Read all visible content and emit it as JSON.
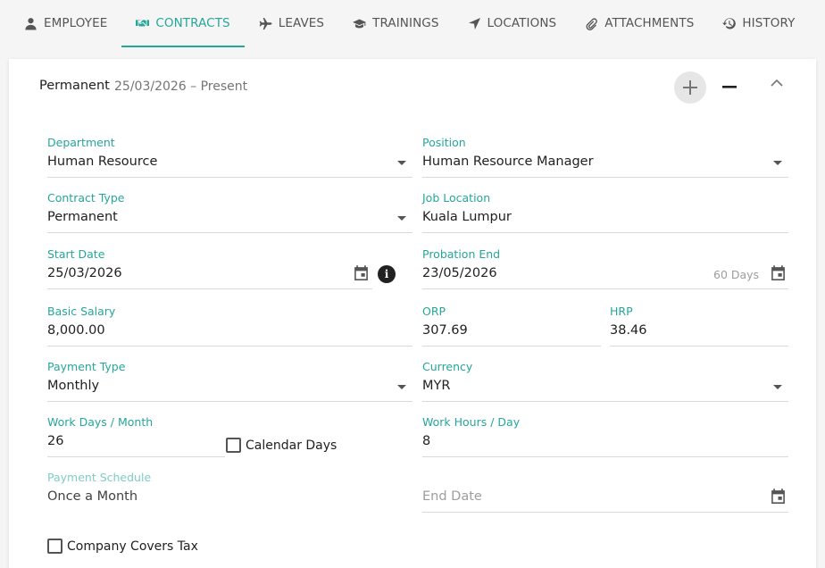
{
  "tabs": [
    {
      "label": "EMPLOYEE",
      "icon": "person-icon"
    },
    {
      "label": "CONTRACTS",
      "icon": "handshake-icon"
    },
    {
      "label": "LEAVES",
      "icon": "airplane-icon"
    },
    {
      "label": "TRAININGS",
      "icon": "graduation-cap-icon"
    },
    {
      "label": "LOCATIONS",
      "icon": "location-arrow-icon"
    },
    {
      "label": "ATTACHMENTS",
      "icon": "paperclip-icon"
    },
    {
      "label": "HISTORY",
      "icon": "history-icon"
    }
  ],
  "active_tab": "CONTRACTS",
  "accent_color": "#26a69a",
  "contract": {
    "header_type": "Permanent",
    "header_dates": "25/03/2026 – Present",
    "department": {
      "label": "Department",
      "value": "Human Resource"
    },
    "position": {
      "label": "Position",
      "value": "Human Resource Manager"
    },
    "contract_type": {
      "label": "Contract Type",
      "value": "Permanent"
    },
    "job_location": {
      "label": "Job Location",
      "value": "Kuala Lumpur"
    },
    "start_date": {
      "label": "Start Date",
      "value": "25/03/2026"
    },
    "probation_end": {
      "label": "Probation End",
      "value": "23/05/2026",
      "days": "60 Days"
    },
    "basic_salary": {
      "label": "Basic Salary",
      "value": "8,000.00"
    },
    "orp": {
      "label": "ORP",
      "value": "307.69"
    },
    "hrp": {
      "label": "HRP",
      "value": "38.46"
    },
    "payment_type": {
      "label": "Payment Type",
      "value": "Monthly"
    },
    "currency": {
      "label": "Currency",
      "value": "MYR"
    },
    "work_days": {
      "label": "Work Days / Month",
      "value": "26"
    },
    "calendar_days": {
      "label": "Calendar Days",
      "checked": false
    },
    "work_hours": {
      "label": "Work Hours / Day",
      "value": "8"
    },
    "payment_schedule": {
      "label": "Payment Schedule",
      "value": "Once a Month"
    },
    "end_date": {
      "placeholder": "End Date"
    },
    "company_covers_tax": {
      "label": "Company Covers Tax",
      "checked": false
    }
  }
}
